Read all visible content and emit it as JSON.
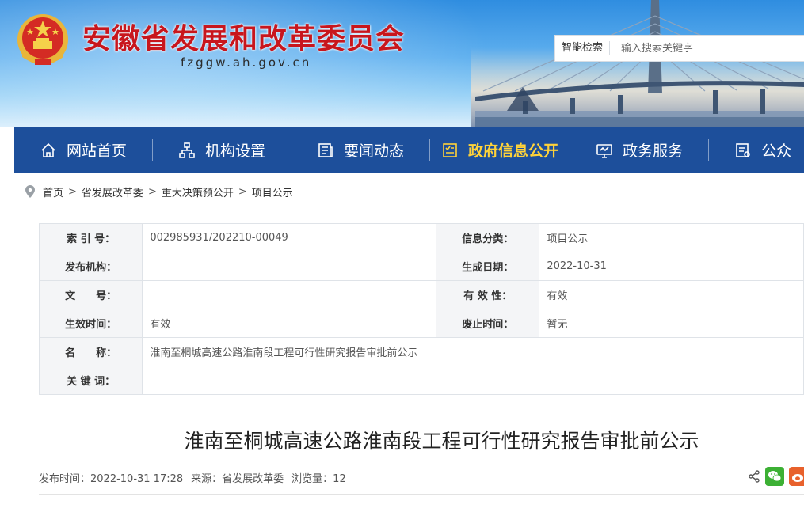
{
  "header": {
    "site_title": "安徽省发展和改革委员会",
    "domain": "fzggw.ah.gov.cn",
    "search_label": "智能检索",
    "search_placeholder": "输入搜索关键字"
  },
  "nav": {
    "items": [
      {
        "label": "网站首页",
        "icon": "home-icon"
      },
      {
        "label": "机构设置",
        "icon": "org-chart-icon"
      },
      {
        "label": "要闻动态",
        "icon": "news-icon"
      },
      {
        "label": "政府信息公开",
        "icon": "open-info-icon",
        "active": true
      },
      {
        "label": "政务服务",
        "icon": "monitor-icon"
      },
      {
        "label": "公众",
        "icon": "document-icon"
      }
    ],
    "active_color": "#ffd33a",
    "background": "#1d4f9b"
  },
  "breadcrumb": [
    "首页",
    "省发展改革委",
    "重大决策预公开",
    "项目公示"
  ],
  "info_table": {
    "index_label": "索 引 号：",
    "index_value": "002985931/202210-00049",
    "category_label": "信息分类：",
    "category_value": "项目公示",
    "publisher_label": "发布机构：",
    "publisher_value": "",
    "created_label": "生成日期：",
    "created_value": "2022-10-31",
    "doc_no_label": "文　　号：",
    "doc_no_value": "",
    "validity_label": "有 效 性：",
    "validity_value": "有效",
    "effective_label": "生效时间：",
    "effective_value": "有效",
    "expiry_label": "废止时间：",
    "expiry_value": "暂无",
    "name_label": "名　　称：",
    "name_value": "淮南至桐城高速公路淮南段工程可行性研究报告审批前公示",
    "keywords_label": "关 键 词：",
    "keywords_value": ""
  },
  "article": {
    "title": "淮南至桐城高速公路淮南段工程可行性研究报告审批前公示",
    "publish_time": "发布时间：2022-10-31 17:28",
    "source": "来源：省发展改革委",
    "views": "浏览量：12"
  },
  "colors": {
    "title_red": "#c8161d",
    "wechat_green": "#3cb034",
    "weibo_orange": "#e8612c"
  }
}
